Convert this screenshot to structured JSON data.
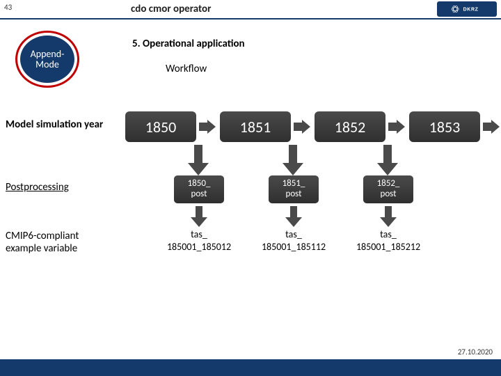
{
  "header": {
    "slide_number": "43",
    "title": "cdo cmor operator",
    "logo_text": "DKRZ"
  },
  "badge": {
    "line1": "Append-",
    "line2": "Mode"
  },
  "section_title": "5. Operational application",
  "subsection_title": "Workflow",
  "rows": {
    "simulation_label": "Model simulation year",
    "postprocessing_label": "Postprocessing",
    "compliant_label": "CMIP6-compliant example variable"
  },
  "years": [
    "1850",
    "1851",
    "1852",
    "1853"
  ],
  "post_boxes": [
    {
      "top": "1850_",
      "bottom": "post"
    },
    {
      "top": "1851_",
      "bottom": "post"
    },
    {
      "top": "1852_",
      "bottom": "post"
    }
  ],
  "tas_labels": [
    {
      "l1": "tas_",
      "l2": "185001_185012"
    },
    {
      "l1": "tas_",
      "l2": "185001_185112"
    },
    {
      "l1": "tas_",
      "l2": "185001_185212"
    }
  ],
  "footer": {
    "date": "27.10.2020"
  }
}
